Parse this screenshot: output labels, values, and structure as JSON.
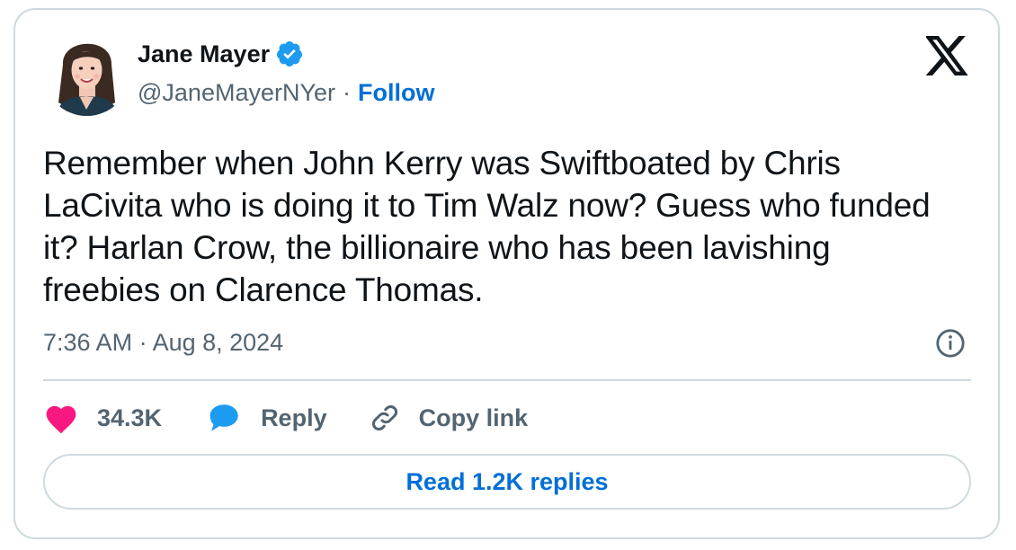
{
  "author": {
    "name": "Jane Mayer",
    "handle": "@JaneMayerNYer",
    "separator": "·",
    "follow_label": "Follow",
    "verified_icon": "verified-badge-icon",
    "verified_color": "#1d9bf0"
  },
  "tweet": {
    "text": "Remember when John Kerry was Swiftboated by Chris LaCivita who is doing it to Tim Walz now? Guess who funded it? Harlan Crow, the billionaire who has been lavishing freebies on Clarence Thomas.",
    "timestamp": "7:36 AM · Aug 8, 2024"
  },
  "actions": {
    "like_count": "34.3K",
    "like_icon": "heart-icon",
    "like_color": "#f91880",
    "reply_label": "Reply",
    "reply_icon": "speech-bubble-icon",
    "reply_color": "#1d9bf0",
    "copy_label": "Copy link",
    "copy_icon": "link-icon"
  },
  "footer": {
    "read_replies_label": "Read 1.2K replies"
  },
  "colors": {
    "link_blue": "#006fd6",
    "muted": "#536471",
    "border": "#cfd9de",
    "text": "#0f1419"
  }
}
